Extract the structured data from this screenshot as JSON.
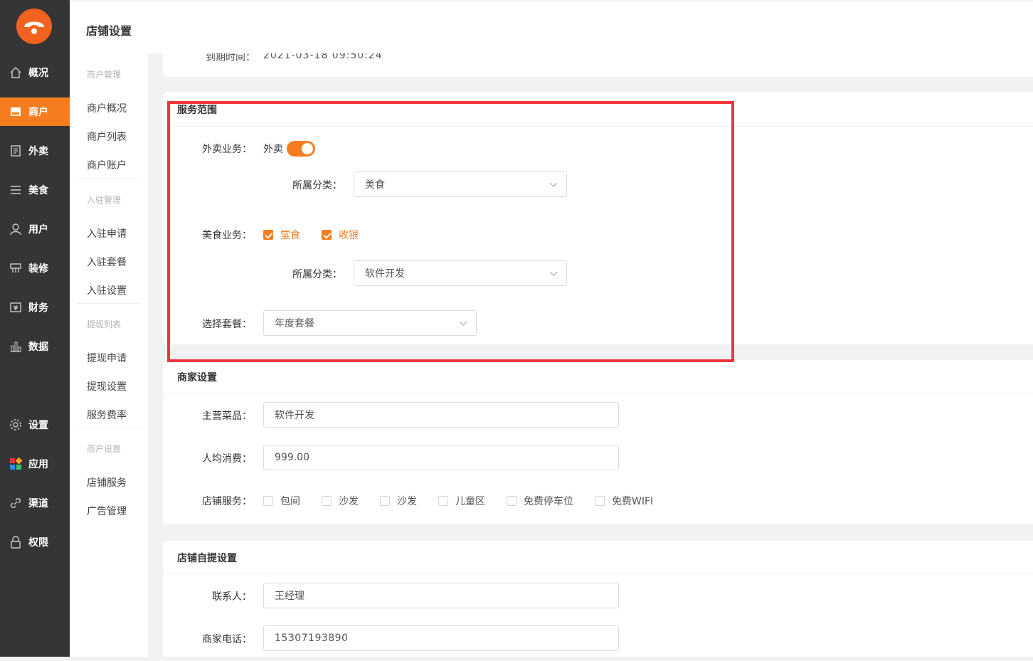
{
  "sidebar": {
    "items": [
      {
        "label": "概况",
        "icon": "home-icon"
      },
      {
        "label": "商户",
        "icon": "store-icon",
        "active": true
      },
      {
        "label": "外卖",
        "icon": "document-icon"
      },
      {
        "label": "美食",
        "icon": "menu-icon"
      },
      {
        "label": "用户",
        "icon": "user-icon"
      },
      {
        "label": "装修",
        "icon": "decor-icon"
      },
      {
        "label": "财务",
        "icon": "yen-wallet-icon"
      },
      {
        "label": "数据",
        "icon": "bar-chart-icon"
      },
      {
        "label": "设置",
        "icon": "gear-icon"
      },
      {
        "label": "应用",
        "icon": "apps-icon"
      },
      {
        "label": "渠道",
        "icon": "link-icon"
      },
      {
        "label": "权限",
        "icon": "lock-icon"
      }
    ]
  },
  "subnav": {
    "groups": [
      {
        "title": "商户管理",
        "items": [
          "商户概况",
          "商户列表",
          "商户账户"
        ]
      },
      {
        "title": "入驻管理",
        "items": [
          "入驻申请",
          "入驻套餐",
          "入驻设置"
        ]
      },
      {
        "title": "提现列表",
        "items": [
          "提现申请",
          "提现设置",
          "服务费率"
        ]
      },
      {
        "title": "商户设置",
        "items": [
          "店铺服务",
          "广告管理"
        ]
      }
    ]
  },
  "header": {
    "title": "店铺设置"
  },
  "expiry": {
    "label": "到期时间：",
    "value": "2021-03-18 09:50:24"
  },
  "service_scope": {
    "title": "服务范围",
    "takeout_label": "外卖业务：",
    "takeout_option": "外卖",
    "takeout_enabled": true,
    "takeout_category_label": "所属分类：",
    "takeout_category_value": "美食",
    "food_label": "美食业务：",
    "food_options": [
      {
        "label": "堂食",
        "checked": true
      },
      {
        "label": "收银",
        "checked": true
      }
    ],
    "food_category_label": "所属分类：",
    "food_category_value": "软件开发",
    "package_label": "选择套餐：",
    "package_value": "年度套餐"
  },
  "merchant": {
    "title": "商家设置",
    "main_dish_label": "主营菜品：",
    "main_dish_value": "软件开发",
    "avg_spend_label": "人均消费：",
    "avg_spend_value": "999.00",
    "services_label": "店铺服务：",
    "services": [
      {
        "label": "包间",
        "checked": false
      },
      {
        "label": "沙发",
        "checked": false
      },
      {
        "label": "沙发",
        "checked": false
      },
      {
        "label": "儿童区",
        "checked": false
      },
      {
        "label": "免费停车位",
        "checked": false
      },
      {
        "label": "免费WIFI",
        "checked": false
      }
    ]
  },
  "pickup": {
    "title": "店铺自提设置",
    "contact_label": "联系人：",
    "contact_value": "王经理",
    "phone_label": "商家电话：",
    "phone_value": "15307193890"
  },
  "colors": {
    "accent": "#f57d1f",
    "sidebar": "#353535",
    "highlight": "#f0353d"
  }
}
